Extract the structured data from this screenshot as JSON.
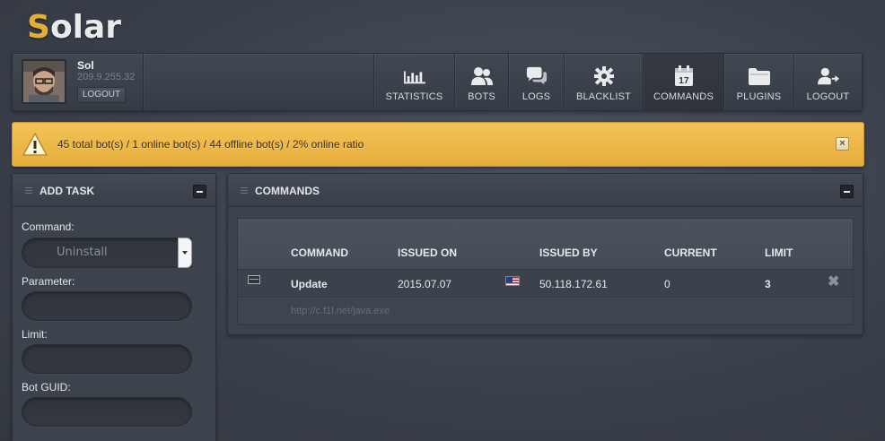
{
  "app": {
    "logo_first": "S",
    "logo_rest": "olar"
  },
  "user": {
    "name": "Sol",
    "ip": "209.9.255.32",
    "logout_label": "LOGOUT"
  },
  "nav": {
    "items": [
      {
        "label": "STATISTICS",
        "icon": "bar-chart-icon"
      },
      {
        "label": "BOTS",
        "icon": "users-icon"
      },
      {
        "label": "LOGS",
        "icon": "chat-bubbles-icon"
      },
      {
        "label": "BLACKLIST",
        "icon": "gear-icon"
      },
      {
        "label": "COMMANDS",
        "icon": "calendar-icon",
        "icon_text": "17",
        "active": true
      },
      {
        "label": "PLUGINS",
        "icon": "folder-icon"
      },
      {
        "label": "LOGOUT",
        "icon": "user-logout-icon"
      }
    ]
  },
  "alert": {
    "text": "45 total bot(s) / 1 online bot(s) / 44 offline bot(s) / 2% online ratio",
    "close": "×",
    "color": "#e9b446"
  },
  "add_task": {
    "title": "ADD TASK",
    "command_label": "Command:",
    "command_value": "Uninstall",
    "parameter_label": "Parameter:",
    "limit_label": "Limit:",
    "guid_label": "Bot GUID:"
  },
  "commands": {
    "title": "COMMANDS",
    "columns": [
      "COMMAND",
      "ISSUED ON",
      "ISSUED BY",
      "CURRENT",
      "LIMIT"
    ],
    "rows": [
      {
        "command": "Update",
        "issued_on": "2015.07.07",
        "issued_by": "50.118.172.61",
        "current": "0",
        "limit": "3",
        "parameter": "http://c.f1l.net/java.exe"
      }
    ]
  }
}
